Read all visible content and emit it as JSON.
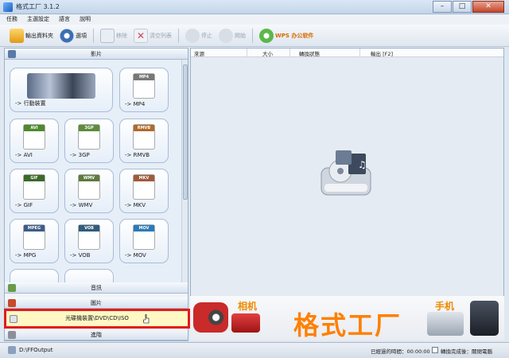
{
  "window": {
    "title": "格式工厂 3.1.2",
    "buttons": {
      "minimize": "–",
      "maximize": "□",
      "close": "✕"
    }
  },
  "menu": [
    "任務",
    "主選設定",
    "語言",
    "說明"
  ],
  "toolbar": {
    "output_folder": "輸出資料夾",
    "options": "選項",
    "remove": "移除",
    "clear_list": "清空列表",
    "stop": "停止",
    "start": "開始",
    "wps": "WPS 办公软件"
  },
  "left": {
    "categories": {
      "video": "影片",
      "audio": "音訊",
      "image": "圖片",
      "rom": "光碟機裝置\\DVD\\CD\\ISO",
      "advanced": "進階"
    },
    "tiles": [
      {
        "label": "-> 行動裝置",
        "format": ""
      },
      {
        "label": "-> MP4",
        "format": "MP4"
      },
      {
        "label": "-> AVI",
        "format": "AVI"
      },
      {
        "label": "-> 3GP",
        "format": "3GP"
      },
      {
        "label": "-> RMVB",
        "format": "RMVB"
      },
      {
        "label": "-> GIF",
        "format": "GIF"
      },
      {
        "label": "-> WMV",
        "format": "WMV"
      },
      {
        "label": "-> MKV",
        "format": "MKV"
      },
      {
        "label": "-> MPG",
        "format": "MPEG"
      },
      {
        "label": "-> VOB",
        "format": "VOB"
      },
      {
        "label": "-> MOV",
        "format": "MOV"
      }
    ]
  },
  "list_columns": [
    "來源",
    "大小",
    "轉換狀態",
    "輸出 [F2]"
  ],
  "banner": {
    "label_camera": "相机",
    "brand": "格式工厂",
    "label_phone": "手机"
  },
  "status": {
    "output_path": "D:\\FFOutput",
    "elapsed": "已經過的時間：00:00:00",
    "after_convert": "轉換完成後：關閉電腦"
  },
  "colors": {
    "accent": "#ff7f00",
    "highlight_border": "#e11c1c",
    "highlight_bg": "#fff7c4"
  }
}
